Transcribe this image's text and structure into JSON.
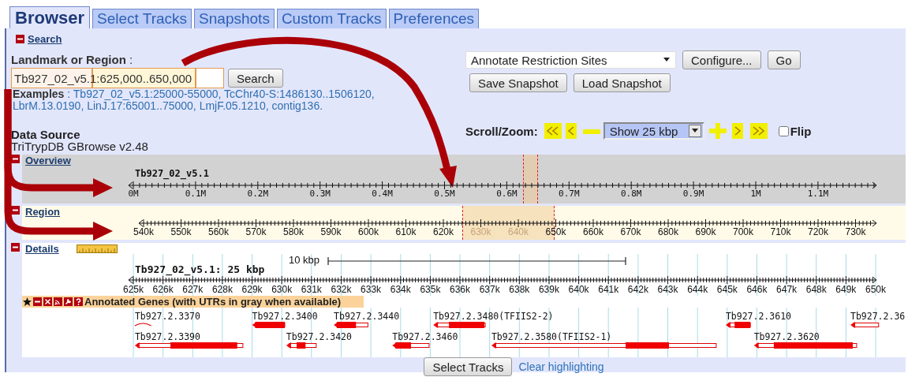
{
  "tabs": [
    {
      "label": "Browser",
      "selected": true
    },
    {
      "label": "Select Tracks",
      "selected": false
    },
    {
      "label": "Snapshots",
      "selected": false
    },
    {
      "label": "Custom Tracks",
      "selected": false
    },
    {
      "label": "Preferences",
      "selected": false
    }
  ],
  "search_section": {
    "title": "Search",
    "expanded": true
  },
  "landmark_label": "**Landmark or Region** :",
  "search_field": {
    "value": "Tb927_02_v5.1:625,000..650,000"
  },
  "search_button": "Search",
  "examples": "**Examples** : Tb927_02_v5.1:25000-55000, TcChr40-S:1486130..1506120, LbrM.13.0190, LinJ.17:65001..75000, LmjF.05.1210, contig136.",
  "data_source": {
    "label": "Data Source",
    "value": "TriTrypDB GBrowse v2.48"
  },
  "plugin": {
    "selected": "Annotate Restriction Sites",
    "buttons": [
      "Configure...",
      "Go"
    ]
  },
  "snapshot_buttons": [
    "Save Snapshot",
    "Load Snapshot"
  ],
  "scroll_zoom": {
    "label": "Scroll/Zoom:",
    "range": "Show 25 kbp",
    "flip": {
      "label": "Flip",
      "checked": false
    }
  },
  "overview": {
    "title": "Overview",
    "expanded": true,
    "sequence": "Tb927_02_v5.1",
    "ticks": [
      "0M",
      "0.1M",
      "0.2M",
      "0.3M",
      "0.4M",
      "0.5M",
      "0.6M",
      "0.7M",
      "0.8M",
      "0.9M",
      "1M",
      "1.1M"
    ]
  },
  "region": {
    "title": "Region",
    "expanded": true,
    "ticks": [
      "540k",
      "550k",
      "560k",
      "570k",
      "580k",
      "590k",
      "600k",
      "610k",
      "620k",
      "630k",
      "640k",
      "650k",
      "660k",
      "670k",
      "680k",
      "690k",
      "700k",
      "710k",
      "720k",
      "730k"
    ]
  },
  "details": {
    "title": "Details",
    "expanded": true,
    "heading": "Tb927_02_v5.1: 25 kbp",
    "scale_label": "10 kbp",
    "ticks": [
      "625k",
      "626k",
      "627k",
      "628k",
      "629k",
      "630k",
      "631k",
      "632k",
      "633k",
      "634k",
      "635k",
      "636k",
      "637k",
      "638k",
      "639k",
      "640k",
      "641k",
      "642k",
      "643k",
      "644k",
      "645k",
      "646k",
      "647k",
      "648k",
      "649k",
      "650k"
    ],
    "track": {
      "title": "Annotated Genes (with UTRs in gray when available)",
      "genes": [
        {
          "label": "Tb927.2.3370",
          "kind": "partial"
        },
        {
          "label": "Tb927.2.3400",
          "kind": "transcript"
        },
        {
          "label": "Tb927.2.3440",
          "kind": "transcript"
        },
        {
          "label": "Tb927.2.3480(TFIIS2-2)",
          "kind": "transcript"
        },
        {
          "label": "Tb927.2.3610",
          "kind": "transcript"
        },
        {
          "label": "Tb927.2.36",
          "kind": "transcript"
        },
        {
          "label": "Tb927.2.3390",
          "kind": "transcript"
        },
        {
          "label": "Tb927.2.3420",
          "kind": "transcript"
        },
        {
          "label": "Tb927.2.3460",
          "kind": "transcript"
        },
        {
          "label": "Tb927.2.3580(TFIIS2-1)",
          "kind": "transcript"
        },
        {
          "label": "Tb927.2.3620",
          "kind": "transcript"
        }
      ]
    }
  },
  "footer": {
    "button": "Select Tracks",
    "link": "Clear highlighting"
  }
}
